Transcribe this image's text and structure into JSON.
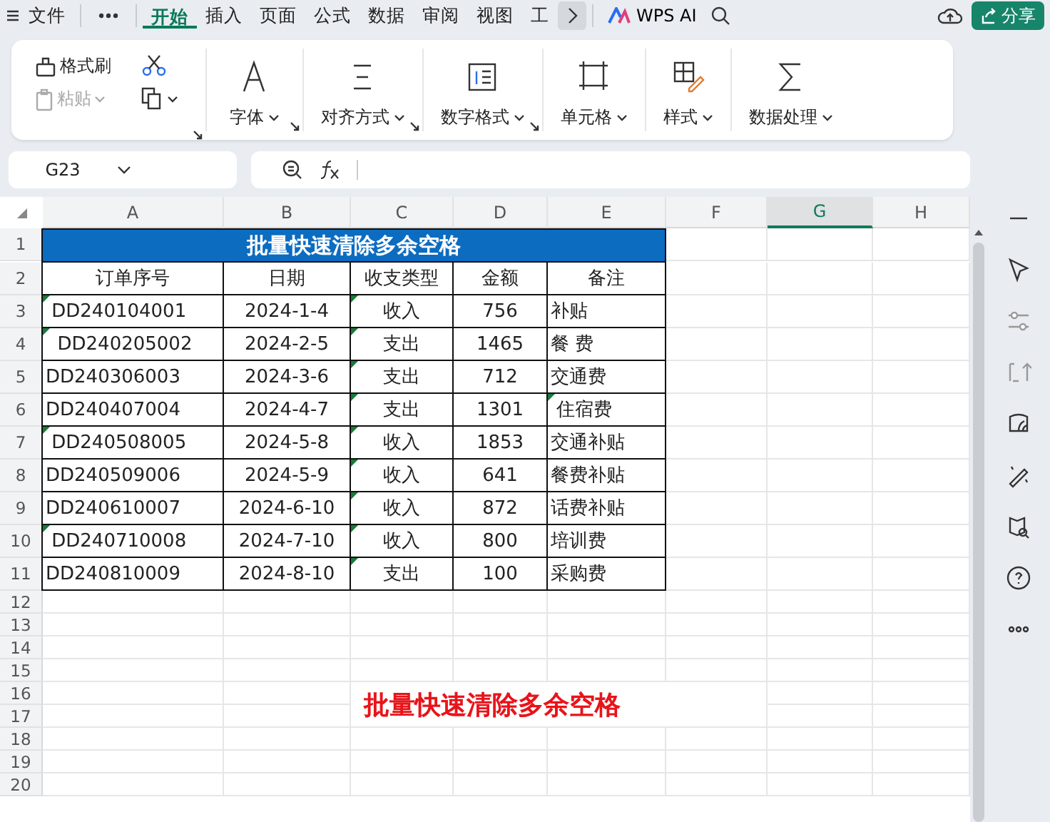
{
  "menu_bar": {
    "items": [
      {
        "label": "文件",
        "selected": false
      },
      {
        "label": "开始",
        "selected": true
      },
      {
        "label": "插入",
        "selected": false
      },
      {
        "label": "页面",
        "selected": false
      },
      {
        "label": "公式",
        "selected": false
      },
      {
        "label": "数据",
        "selected": false
      },
      {
        "label": "审阅",
        "selected": false
      },
      {
        "label": "视图",
        "selected": false
      },
      {
        "label": "工",
        "selected": false
      }
    ],
    "ai_label": "WPS AI",
    "share_label": "分享"
  },
  "ribbon": {
    "clipboard": {
      "format_painter": "格式刷",
      "paste": "粘贴",
      "paste_disabled": true,
      "launcher": true
    },
    "groups": [
      {
        "kind": "font",
        "label": "字体",
        "launcher": true
      },
      {
        "kind": "align",
        "label": "对齐方式",
        "launcher": true
      },
      {
        "kind": "number",
        "label": "数字格式",
        "launcher": true
      },
      {
        "kind": "cell",
        "label": "单元格",
        "launcher": false
      },
      {
        "kind": "style",
        "label": "样式",
        "launcher": false
      },
      {
        "kind": "sum",
        "label": "数据处理",
        "launcher": false
      }
    ]
  },
  "formula_bar": {
    "name_box": "G23"
  },
  "sheet": {
    "columns": [
      {
        "label": "A",
        "selected": false
      },
      {
        "label": "B",
        "selected": false
      },
      {
        "label": "C",
        "selected": false
      },
      {
        "label": "D",
        "selected": false
      },
      {
        "label": "E",
        "selected": false
      },
      {
        "label": "F",
        "selected": false
      },
      {
        "label": "G",
        "selected": true
      },
      {
        "label": "H",
        "selected": false
      }
    ],
    "row_numbers": [
      "1",
      "2",
      "3",
      "4",
      "5",
      "6",
      "7",
      "8",
      "9",
      "10",
      "11",
      "12",
      "13",
      "14",
      "15",
      "16",
      "17",
      "18",
      "19",
      "20"
    ],
    "title": "批量快速清除多余空格",
    "headers": [
      "订单序号",
      "日期",
      "收支类型",
      "金额",
      "备注"
    ],
    "rows": [
      {
        "cells": [
          " DD240104001",
          "2024-1-4",
          "收入",
          "756",
          "补贴"
        ],
        "flags": [
          true,
          false,
          true,
          false,
          false
        ]
      },
      {
        "cells": [
          "  DD240205002",
          "2024-2-5",
          "支出",
          "1465",
          "餐 费"
        ],
        "flags": [
          true,
          false,
          true,
          false,
          false
        ]
      },
      {
        "cells": [
          "DD240306003",
          "2024-3-6",
          "支出",
          "712",
          "交通费"
        ],
        "flags": [
          false,
          false,
          true,
          false,
          false
        ]
      },
      {
        "cells": [
          "DD240407004",
          "2024-4-7",
          "支出",
          "1301",
          " 住宿费"
        ],
        "flags": [
          false,
          false,
          true,
          false,
          true
        ]
      },
      {
        "cells": [
          " DD240508005",
          "2024-5-8",
          "收入",
          "1853",
          "交通补贴"
        ],
        "flags": [
          true,
          false,
          true,
          false,
          false
        ]
      },
      {
        "cells": [
          "DD240509006",
          "2024-5-9",
          "收入",
          "641",
          "餐费补贴"
        ],
        "flags": [
          false,
          false,
          true,
          false,
          false
        ]
      },
      {
        "cells": [
          "DD240610007",
          "2024-6-10",
          "收入",
          "872",
          "话费补贴"
        ],
        "flags": [
          false,
          false,
          true,
          false,
          false
        ]
      },
      {
        "cells": [
          " DD240710008",
          "2024-7-10",
          "收入",
          "800",
          "培训费"
        ],
        "flags": [
          true,
          false,
          true,
          false,
          false
        ]
      },
      {
        "cells": [
          "DD240810009",
          "2024-8-10",
          "支出",
          "100",
          "采购费"
        ],
        "flags": [
          false,
          false,
          true,
          false,
          false
        ]
      }
    ],
    "caption": "批量快速清除多余空格"
  }
}
